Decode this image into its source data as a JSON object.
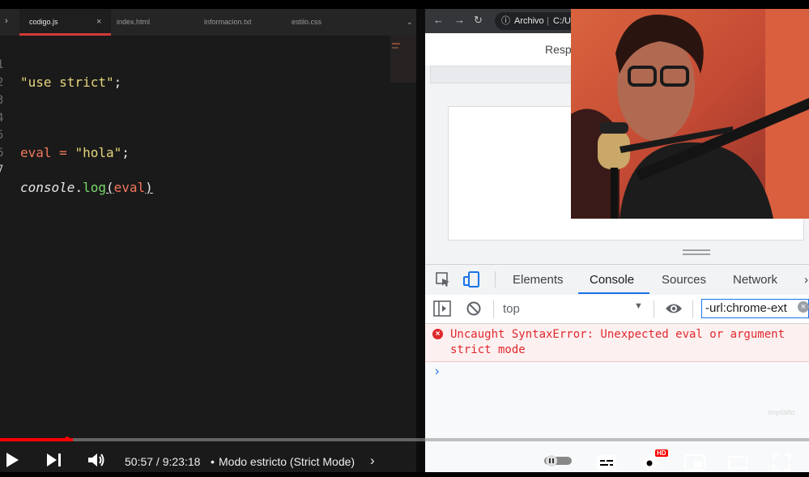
{
  "editor": {
    "tabs": [
      {
        "label": "codigo.js",
        "active": true
      },
      {
        "label": "index.html"
      },
      {
        "label": "informacion.txt"
      },
      {
        "label": "estilo.css"
      }
    ],
    "line_numbers": [
      "1",
      "2",
      "3",
      "4",
      "5",
      "6",
      "7"
    ],
    "code": {
      "line1_string": "\"use strict\"",
      "line1_semi": ";",
      "line5_var": "eval",
      "line5_eq": " = ",
      "line5_string": "\"hola\"",
      "line5_semi": ";",
      "line7_obj": "console",
      "line7_dot": ".",
      "line7_fn": "log",
      "line7_open": "(",
      "line7_arg": "eval",
      "line7_close": ")"
    }
  },
  "browser": {
    "url_prefix": "Archivo",
    "url_path": "C:/U",
    "responsive_label": "Resp"
  },
  "devtools": {
    "tabs": [
      "Elements",
      "Console",
      "Sources",
      "Network"
    ],
    "active_tab": "Console",
    "context": "top",
    "filter_value": "-url:chrome-ext",
    "error_line1": "Uncaught SyntaxError: Unexpected eval or argument",
    "error_line2": "strict mode",
    "prompt": "›"
  },
  "watermark": "soydalto",
  "player": {
    "time": "50:57 / 9:23:18",
    "separator": "•",
    "chapter": "Modo estricto (Strict Mode)",
    "progress_fraction": 0.09,
    "hd_badge": "HD"
  },
  "colors": {
    "progress": "#ff0000",
    "error_text": "#e0282c",
    "devtools_accent": "#1a73e8",
    "tab_underline": "#d43a3a"
  }
}
